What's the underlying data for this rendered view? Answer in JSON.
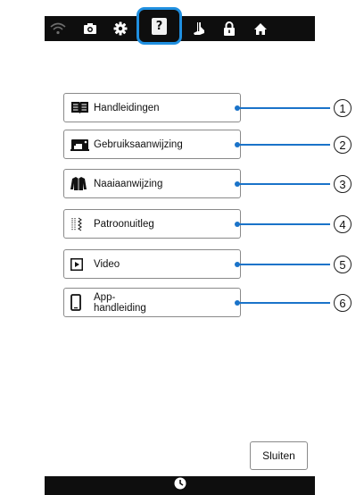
{
  "toolbar": {
    "icons": [
      "wifi-icon",
      "camera-icon",
      "settings-gear-icon",
      "help-icon",
      "presser-foot-icon",
      "lock-icon",
      "home-icon"
    ],
    "help_label": "?"
  },
  "menu": {
    "items": [
      {
        "label": "Handleidingen",
        "icon": "book-icon",
        "number": "1"
      },
      {
        "label": "Gebruiksaanwijzing",
        "icon": "sewing-machine-icon",
        "number": "2"
      },
      {
        "label": "Naaiaanwijzing",
        "icon": "jacket-icon",
        "number": "3"
      },
      {
        "label": "Patroonuitleg",
        "icon": "stitch-pattern-icon",
        "number": "4"
      },
      {
        "label": "Video",
        "icon": "play-icon",
        "number": "5"
      },
      {
        "label": "App-\nhandleiding",
        "icon": "phone-icon",
        "number": "6"
      }
    ]
  },
  "footer": {
    "close_label": "Sluiten",
    "bottom_icon": "clock-icon"
  },
  "colors": {
    "accent": "#1f8fe0",
    "callout": "#1a73c9",
    "bar": "#0e0e0e"
  }
}
